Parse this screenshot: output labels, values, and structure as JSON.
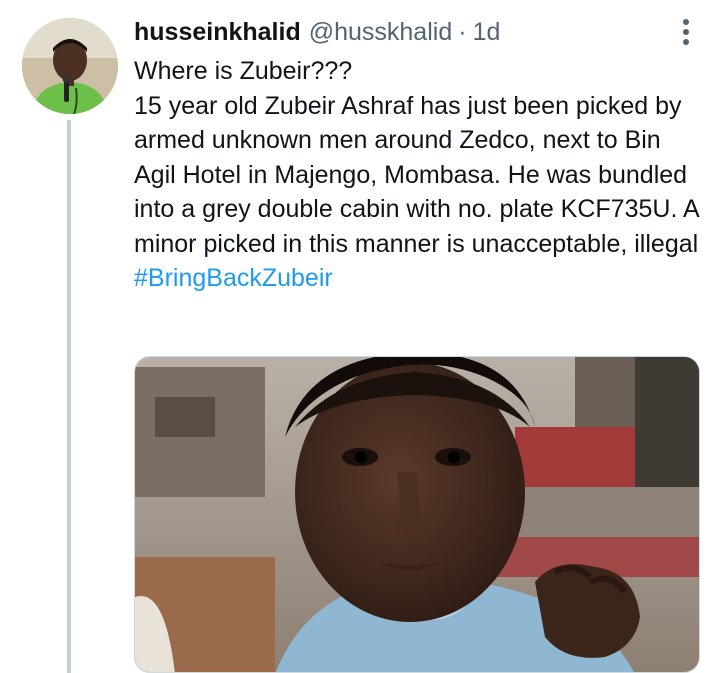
{
  "tweet": {
    "author": {
      "display_name": "husseinkhalid",
      "handle": "@husskhalid",
      "separator": "·",
      "timestamp": "1d",
      "avatar_icon": "user-avatar-photo"
    },
    "more_icon": "more-vertical-icon",
    "text": {
      "line1": "Where is Zubeir???",
      "body": "15 year old Zubeir Ashraf has just been picked by armed unknown men around Zedco, next to Bin Agil Hotel in Majengo, Mombasa. He was bundled into a grey double cabin with no. plate KCF735U. A minor picked in this manner is unacceptable, illegal ",
      "hashtag": "#BringBackZubeir"
    },
    "media": {
      "type": "photo"
    }
  },
  "colors": {
    "text": "#0f1419",
    "secondary": "#536471",
    "link": "#1d9bf0",
    "thread_line": "#c4cfd6"
  }
}
